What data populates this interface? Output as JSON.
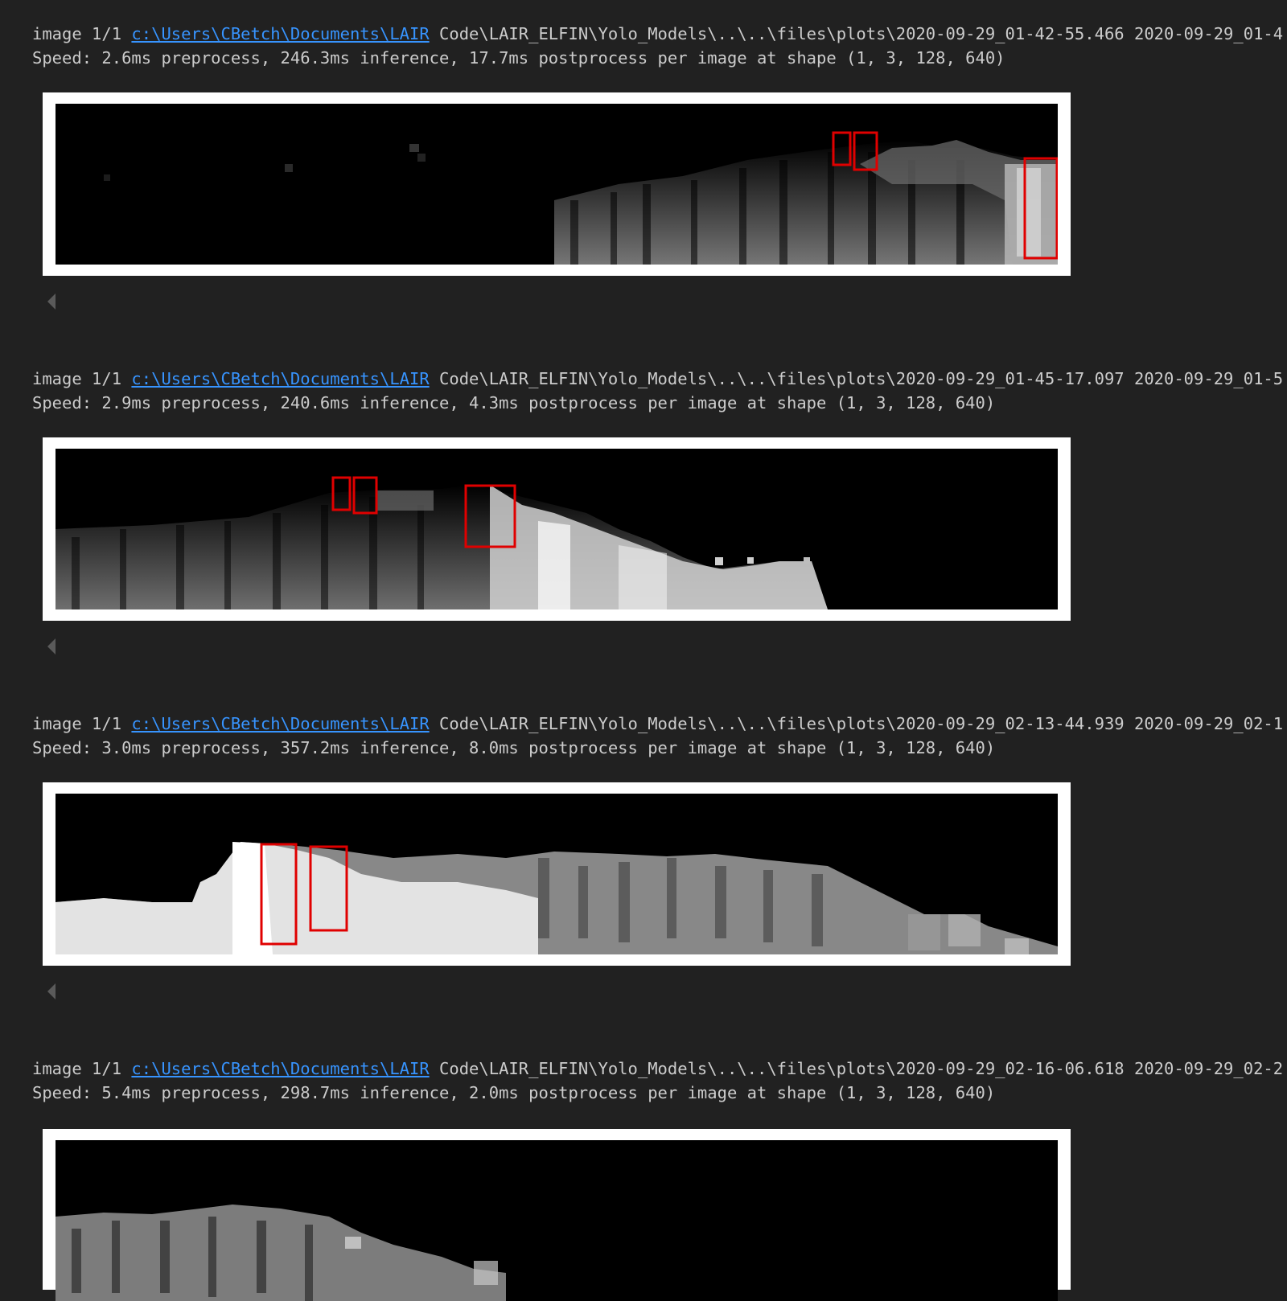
{
  "colors": {
    "background": "#212121",
    "text": "#cccccc",
    "link": "#3794ff",
    "detection_box": "#e00000"
  },
  "outputs": [
    {
      "image_prefix": "image 1/1 ",
      "path_link": "c:\\Users\\CBetch\\Documents\\LAIR",
      "path_rest": " Code\\LAIR_ELFIN\\Yolo_Models\\..\\..\\files\\plots\\2020-09-29_01-42-55.466 2020-09-29_01-4",
      "speed": "Speed: 2.6ms preprocess, 246.3ms inference, 17.7ms postprocess per image at shape (1, 3, 128, 640)",
      "collapse_icon": "triangle-left-icon"
    },
    {
      "image_prefix": "image 1/1 ",
      "path_link": "c:\\Users\\CBetch\\Documents\\LAIR",
      "path_rest": " Code\\LAIR_ELFIN\\Yolo_Models\\..\\..\\files\\plots\\2020-09-29_01-45-17.097 2020-09-29_01-5",
      "speed": "Speed: 2.9ms preprocess, 240.6ms inference, 4.3ms postprocess per image at shape (1, 3, 128, 640)",
      "collapse_icon": "triangle-left-icon"
    },
    {
      "image_prefix": "image 1/1 ",
      "path_link": "c:\\Users\\CBetch\\Documents\\LAIR",
      "path_rest": " Code\\LAIR_ELFIN\\Yolo_Models\\..\\..\\files\\plots\\2020-09-29_02-13-44.939 2020-09-29_02-1",
      "speed": "Speed: 3.0ms preprocess, 357.2ms inference, 8.0ms postprocess per image at shape (1, 3, 128, 640)",
      "collapse_icon": "triangle-left-icon"
    },
    {
      "image_prefix": "image 1/1 ",
      "path_link": "c:\\Users\\CBetch\\Documents\\LAIR",
      "path_rest": " Code\\LAIR_ELFIN\\Yolo_Models\\..\\..\\files\\plots\\2020-09-29_02-16-06.618 2020-09-29_02-2",
      "speed": "Speed: 5.4ms preprocess, 298.7ms inference, 2.0ms postprocess per image at shape (1, 3, 128, 640)",
      "collapse_icon": "triangle-left-icon"
    }
  ]
}
